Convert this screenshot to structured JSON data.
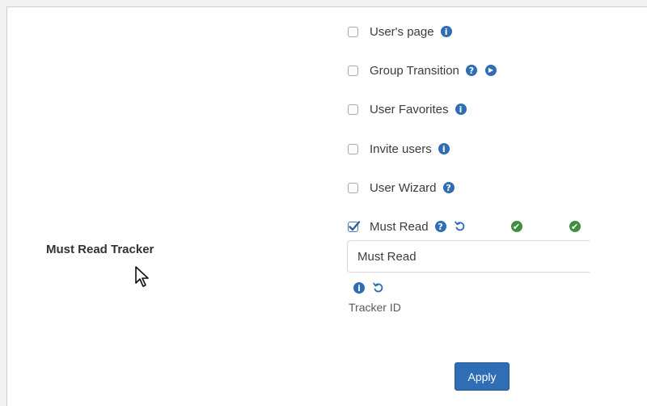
{
  "options": [
    {
      "label": "User's page",
      "checked": false,
      "icons": [
        "info-icon"
      ]
    },
    {
      "label": "Group Transition",
      "checked": false,
      "icons": [
        "help-icon",
        "play-icon"
      ]
    },
    {
      "label": "User Favorites",
      "checked": false,
      "icons": [
        "info-icon"
      ]
    },
    {
      "label": "Invite users",
      "checked": false,
      "icons": [
        "info-icon"
      ]
    },
    {
      "label": "User Wizard",
      "checked": false,
      "icons": [
        "help-icon"
      ]
    },
    {
      "label": "Must Read",
      "checked": true,
      "icons": [
        "help-icon",
        "reset-icon",
        "check-icon",
        "check-icon"
      ]
    }
  ],
  "tracker": {
    "section_label": "Must Read Tracker",
    "input_value": "Must Read",
    "field_label": "Tracker ID"
  },
  "apply_label": "Apply",
  "colors": {
    "accent": "#2f6db5",
    "success": "#3e8f3e"
  }
}
